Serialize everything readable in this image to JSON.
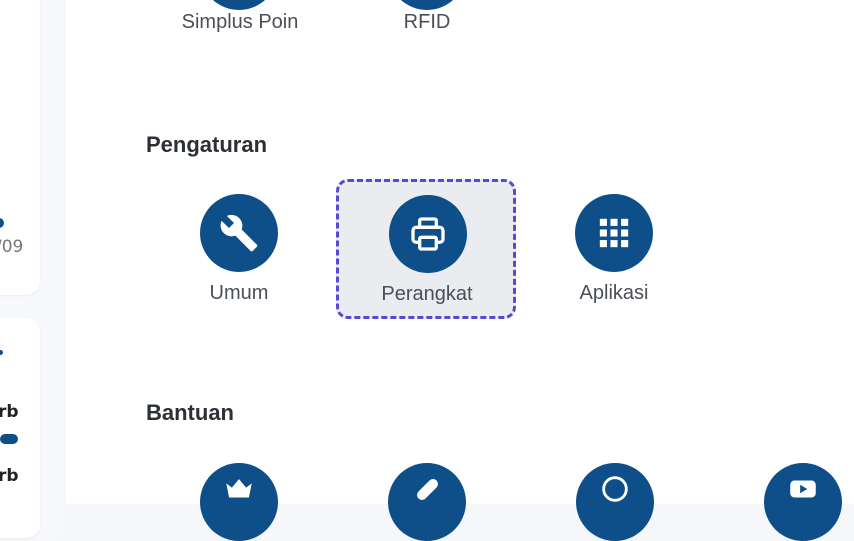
{
  "sidebar": {
    "fragment_1": "/09",
    "fragment_2": "rb",
    "fragment_3": "rb"
  },
  "top_items": [
    {
      "label": "Simplus Poin"
    },
    {
      "label": "RFID"
    }
  ],
  "pengaturan": {
    "title": "Pengaturan",
    "items": [
      {
        "label": "Umum",
        "icon": "wrench-icon"
      },
      {
        "label": "Perangkat",
        "icon": "printer-icon",
        "selected": true
      },
      {
        "label": "Aplikasi",
        "icon": "grid-icon"
      }
    ]
  },
  "bantuan": {
    "title": "Bantuan",
    "items": [
      {
        "icon": "crown-icon"
      },
      {
        "icon": "bandage-icon"
      },
      {
        "icon": "whatsapp-icon"
      },
      {
        "icon": "youtube-icon"
      }
    ]
  },
  "colors": {
    "accent": "#0e4f8a",
    "selection_border": "#5848d6",
    "selection_bg": "#eaecf0"
  }
}
